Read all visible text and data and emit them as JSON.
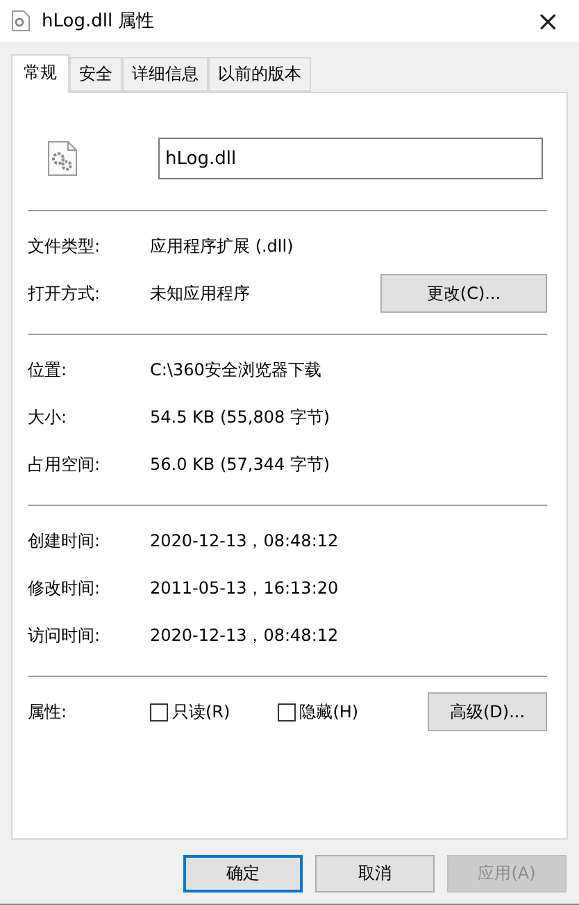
{
  "window": {
    "title": "hLog.dll 属性",
    "close": "×"
  },
  "tabs": [
    {
      "label": "常规",
      "selected": true
    },
    {
      "label": "安全",
      "selected": false
    },
    {
      "label": "详细信息",
      "selected": false
    },
    {
      "label": "以前的版本",
      "selected": false
    }
  ],
  "file_name": "hLog.dll",
  "groups": [
    [
      {
        "label": "文件类型:",
        "value": "应用程序扩展 (.dll)"
      },
      {
        "label": "打开方式:",
        "value": "未知应用程序",
        "button": "更改(C)..."
      }
    ],
    [
      {
        "label": "位置:",
        "value": "C:\\360安全浏览器下载"
      },
      {
        "label": "大小:",
        "value": "54.5 KB (55,808 字节)"
      },
      {
        "label": "占用空间:",
        "value": "56.0 KB (57,344 字节)"
      }
    ],
    [
      {
        "label": "创建时间:",
        "value": "2020-12-13，08:48:12"
      },
      {
        "label": "修改时间:",
        "value": "2011-05-13，16:13:20"
      },
      {
        "label": "访问时间:",
        "value": "2020-12-13，08:48:12"
      }
    ]
  ],
  "attributes": {
    "label": "属性:",
    "options": [
      {
        "label": "只读(R)",
        "checked": false
      },
      {
        "label": "隐藏(H)",
        "checked": false
      }
    ],
    "button": "高级(D)..."
  },
  "footer_buttons": [
    {
      "label": "确定",
      "default": true,
      "disabled": false
    },
    {
      "label": "取消",
      "default": false,
      "disabled": false
    },
    {
      "label": "应用(A)",
      "default": false,
      "disabled": true
    }
  ]
}
